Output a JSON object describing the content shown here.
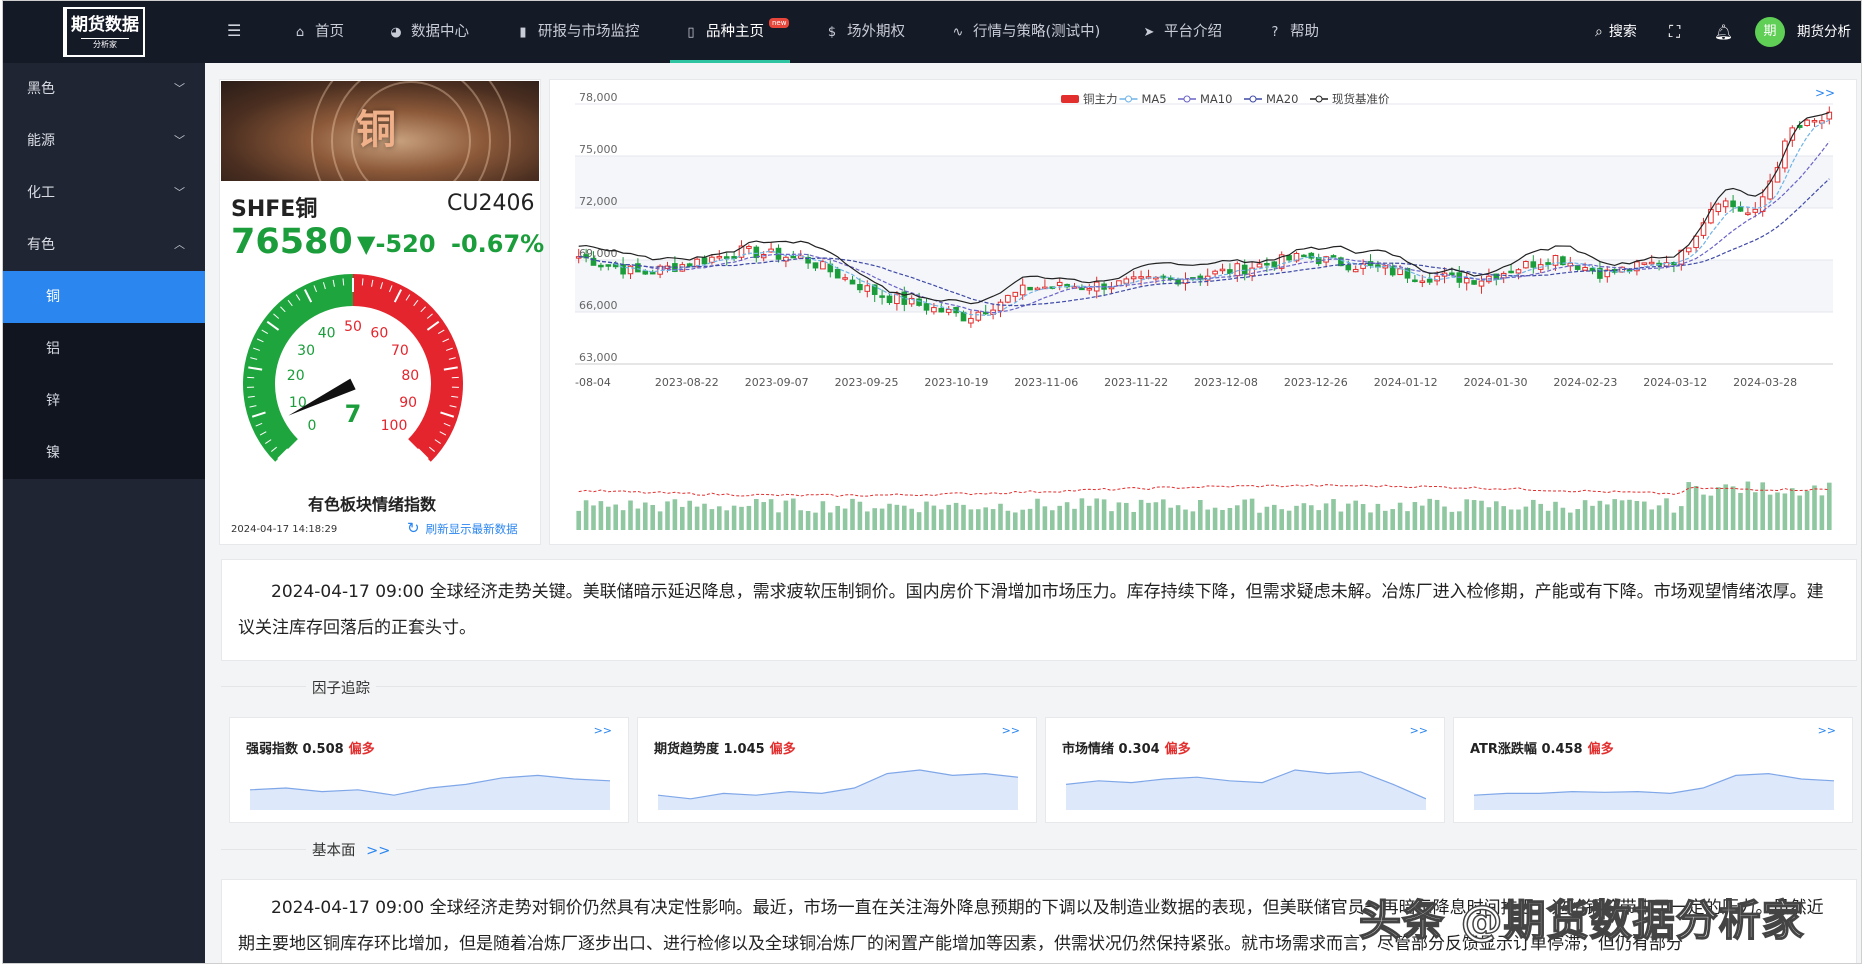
{
  "brand": {
    "line1": "期货数据",
    "line2": "分析家"
  },
  "nav": [
    {
      "label": "首页",
      "icon": "home-icon"
    },
    {
      "label": "数据中心",
      "icon": "pie-chart-icon"
    },
    {
      "label": "研报与市场监控",
      "icon": "bar-chart-icon"
    },
    {
      "label": "品种主页",
      "icon": "book-icon",
      "badge": "new"
    },
    {
      "label": "场外期权",
      "icon": "dollar-icon"
    },
    {
      "label": "行情与策略(测试中)",
      "icon": "pulse-icon"
    },
    {
      "label": "平台介绍",
      "icon": "send-icon"
    },
    {
      "label": "帮助",
      "icon": "help-icon"
    }
  ],
  "topright": {
    "search": "搜索",
    "avatar": "期",
    "user": "期货分析"
  },
  "sidebar": {
    "groups": [
      "黑色",
      "能源",
      "化工",
      "有色"
    ],
    "sub": [
      "铜",
      "铝",
      "锌",
      "镍"
    ]
  },
  "banner": {
    "title": "铜"
  },
  "quote": {
    "name": "SHFE铜",
    "code": "CU2406",
    "price": "76580",
    "change": "▼-520",
    "pct": "-0.67%"
  },
  "gauge": {
    "value": 7,
    "ticks": [
      "0",
      "10",
      "20",
      "30",
      "40",
      "50",
      "60",
      "70",
      "80",
      "90",
      "100"
    ],
    "label": "有色板块情绪指数",
    "time": "2024-04-17 14:18:29",
    "refresh": "刷新显示最新数据"
  },
  "chart_data": {
    "type": "candlestick",
    "legend": [
      "铜主力",
      "MA5",
      "MA10",
      "MA20",
      "现货基准价"
    ],
    "colors": {
      "up": "#e32e2e",
      "down": "#1a9d3a",
      "ma5": "#6fb3e8",
      "ma10": "#6a63c7",
      "ma20": "#3f4aa6",
      "spot": "#222222"
    },
    "y_ticks": [
      "78,000",
      "75,000",
      "72,000",
      "69,000",
      "66,000",
      "63,000"
    ],
    "ylim": [
      63000,
      78000
    ],
    "x_ticks": [
      "-08-04",
      "2023-08-22",
      "2023-09-07",
      "2023-09-25",
      "2023-10-19",
      "2023-11-06",
      "2023-11-22",
      "2023-12-08",
      "2023-12-26",
      "2024-01-12",
      "2024-01-30",
      "2024-02-23",
      "2024-03-12",
      "2024-03-28"
    ],
    "close_anchors": [
      [
        0,
        69200
      ],
      [
        0.05,
        68200
      ],
      [
        0.13,
        69500
      ],
      [
        0.18,
        69100
      ],
      [
        0.24,
        67000
      ],
      [
        0.31,
        65700
      ],
      [
        0.36,
        67400
      ],
      [
        0.43,
        67600
      ],
      [
        0.5,
        68100
      ],
      [
        0.58,
        69200
      ],
      [
        0.67,
        68100
      ],
      [
        0.72,
        67900
      ],
      [
        0.78,
        69200
      ],
      [
        0.82,
        68200
      ],
      [
        0.88,
        69100
      ],
      [
        0.91,
        72600
      ],
      [
        0.94,
        71500
      ],
      [
        0.97,
        76500
      ],
      [
        1.0,
        77200
      ]
    ],
    "more": ">>"
  },
  "news": "2024-04-17 09:00 全球经济走势关键。美联储暗示延迟降息，需求疲软压制铜价。国内房价下滑增加市场压力。库存持续下降，但需求疑虑未解。冶炼厂进入检修期，产能或有下降。市场观望情绪浓厚。建议关注库存回落后的正套头寸。",
  "factor_title": "因子追踪",
  "factors": [
    {
      "name": "强弱指数",
      "value": "0.508",
      "tag": "偏多",
      "spark": [
        0.45,
        0.5,
        0.4,
        0.45,
        0.3,
        0.5,
        0.6,
        0.78,
        0.85,
        0.75,
        0.7
      ]
    },
    {
      "name": "期货趋势度",
      "value": "1.045",
      "tag": "偏多",
      "spark": [
        0.3,
        0.2,
        0.35,
        0.3,
        0.4,
        0.35,
        0.5,
        0.9,
        1.0,
        0.85,
        0.9,
        0.8
      ]
    },
    {
      "name": "市场情绪",
      "value": "0.304",
      "tag": "偏多",
      "spark": [
        0.6,
        0.7,
        0.65,
        0.75,
        0.8,
        0.7,
        0.65,
        1.0,
        0.9,
        0.95,
        0.6,
        0.2
      ]
    },
    {
      "name": "ATR涨跌幅",
      "value": "0.458",
      "tag": "偏多",
      "spark": [
        0.3,
        0.35,
        0.35,
        0.4,
        0.38,
        0.4,
        0.35,
        0.5,
        0.85,
        0.9,
        0.75,
        0.7
      ]
    }
  ],
  "fund_title": "基本面",
  "fund_more": ">>",
  "fund_text": "2024-04-17 09:00 全球经济走势对铜价仍然具有决定性影响。最近，市场一直在关注海外降息预期的下调以及制造业数据的表现，但美联储官员一再暗示降息时间推迟，这给铜价带来了一定的压力。虽然近期主要地区铜库存环比增加，但是随着冶炼厂逐步出口、进行检修以及全球铜冶炼厂的闲置产能增加等因素，供需状况仍然保持紧张。就市场需求而言，尽管部分反馈显示订单停滞，但仍有部分",
  "watermark": "头条 @期货数据分析家"
}
